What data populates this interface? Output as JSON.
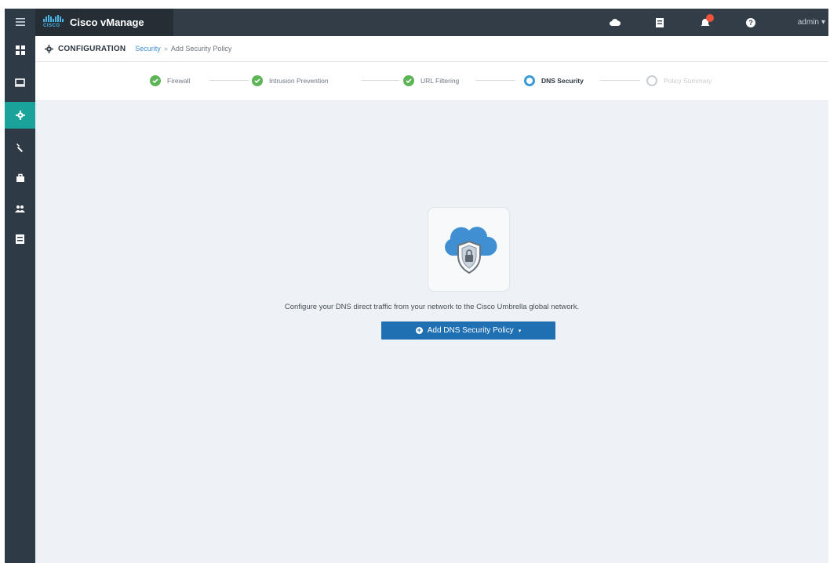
{
  "app": {
    "brand_word": "CISCO",
    "title": "Cisco vManage"
  },
  "topbar": {
    "icons": [
      "cloud-icon",
      "task-list-icon",
      "alarms-icon",
      "help-icon"
    ],
    "alarm_badge": "",
    "user_label": "admin",
    "user_caret": "▾"
  },
  "breadcrumb": {
    "section": "CONFIGURATION",
    "link": "Security",
    "separator": "»",
    "current": "Add Security Policy"
  },
  "stepper": {
    "steps": [
      {
        "label": "Firewall",
        "state": "done"
      },
      {
        "label": "Intrusion Prevention",
        "state": "done"
      },
      {
        "label": "URL Filtering",
        "state": "done"
      },
      {
        "label": "DNS Security",
        "state": "current"
      },
      {
        "label": "Policy Summary",
        "state": "pending"
      }
    ]
  },
  "rail": {
    "items": [
      "menu-icon",
      "dashboard-icon",
      "monitor-icon",
      "configuration-icon",
      "tools-icon",
      "maintenance-icon",
      "administration-icon",
      "analytics-icon"
    ],
    "active_index": 3
  },
  "main": {
    "message": "Configure your DNS direct traffic from your network to the Cisco Umbrella global network.",
    "add_button_label": "Add DNS Security Policy",
    "add_button_caret": "▾"
  },
  "colors": {
    "accent_teal": "#1aa39a",
    "primary_blue": "#1f6fb3",
    "success_green": "#5db456",
    "current_blue": "#3a9bd9"
  }
}
